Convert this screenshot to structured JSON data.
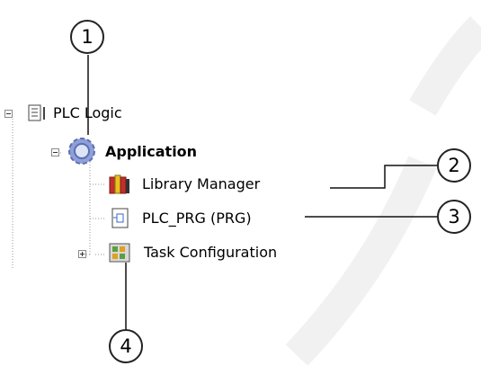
{
  "tree": {
    "root": {
      "label": "PLC Logic",
      "icon": "plc-logic-icon",
      "toggle": "minus"
    },
    "application": {
      "label": "Application",
      "icon": "application-gear-icon",
      "toggle": "minus"
    },
    "children": [
      {
        "label": "Library Manager",
        "icon": "library-books-icon"
      },
      {
        "label": "PLC_PRG (PRG)",
        "icon": "program-pou-icon"
      },
      {
        "label": "Task Configuration",
        "icon": "task-configuration-icon",
        "toggle": "plus"
      }
    ]
  },
  "callouts": [
    "1",
    "2",
    "3",
    "4"
  ],
  "colors": {
    "tree_line": "#9a9a9a",
    "gear": "#5b6fb4",
    "library_red": "#c0302a",
    "library_yellow": "#e8c020",
    "watermark": "#f2f2f2"
  }
}
